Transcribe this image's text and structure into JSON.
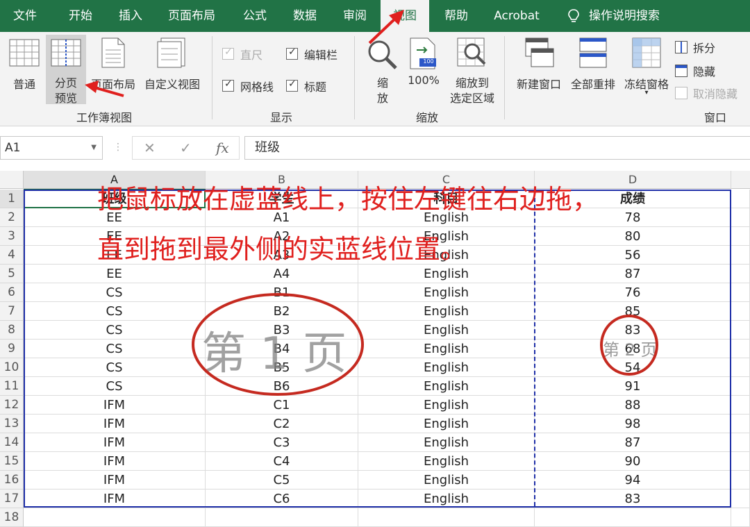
{
  "menu": {
    "tabs": [
      {
        "label": "文件",
        "active": false
      },
      {
        "label": "开始",
        "active": false
      },
      {
        "label": "插入",
        "active": false
      },
      {
        "label": "页面布局",
        "active": false
      },
      {
        "label": "公式",
        "active": false
      },
      {
        "label": "数据",
        "active": false
      },
      {
        "label": "审阅",
        "active": false
      },
      {
        "label": "视图",
        "active": true
      },
      {
        "label": "帮助",
        "active": false
      },
      {
        "label": "Acrobat",
        "active": false
      }
    ],
    "tell_me": "操作说明搜索",
    "accent_color": "#217346"
  },
  "ribbon": {
    "workbook_views": {
      "group_label": "工作簿视图",
      "normal": "普通",
      "page_break_line1": "分页",
      "page_break_line2": "预览",
      "page_layout": "页面布局",
      "custom_views": "自定义视图"
    },
    "show": {
      "group_label": "显示",
      "ruler": {
        "label": "直尺",
        "checked": true,
        "disabled": true
      },
      "formula_bar": {
        "label": "编辑栏",
        "checked": true
      },
      "gridlines": {
        "label": "网格线",
        "checked": true
      },
      "headings": {
        "label": "标题",
        "checked": true
      }
    },
    "zoom": {
      "group_label": "缩放",
      "zoom_line1": "缩",
      "zoom_line2": "放",
      "zoom_100": "100%",
      "zoom_icon_text": "100",
      "zoom_sel_line1": "缩放到",
      "zoom_sel_line2": "选定区域"
    },
    "window": {
      "group_label": "窗口",
      "new_window": "新建窗口",
      "arrange_all": "全部重排",
      "freeze_panes": "冻结窗格",
      "split": "拆分",
      "hide": "隐藏",
      "unhide": "取消隐藏"
    }
  },
  "formula_bar": {
    "name_box": "A1",
    "formula": "班级",
    "fx": "fx"
  },
  "sheet": {
    "columns": [
      "A",
      "B",
      "C",
      "D"
    ],
    "rows": [
      [
        "班级",
        "学生",
        "科目",
        "成绩"
      ],
      [
        "EE",
        "A1",
        "English",
        "78"
      ],
      [
        "EE",
        "A2",
        "English",
        "80"
      ],
      [
        "EE",
        "A3",
        "English",
        "56"
      ],
      [
        "EE",
        "A4",
        "English",
        "87"
      ],
      [
        "CS",
        "B1",
        "English",
        "76"
      ],
      [
        "CS",
        "B2",
        "English",
        "85"
      ],
      [
        "CS",
        "B3",
        "English",
        "83"
      ],
      [
        "CS",
        "B4",
        "English",
        "68"
      ],
      [
        "CS",
        "B5",
        "English",
        "54"
      ],
      [
        "CS",
        "B6",
        "English",
        "91"
      ],
      [
        "IFM",
        "C1",
        "English",
        "88"
      ],
      [
        "IFM",
        "C2",
        "English",
        "98"
      ],
      [
        "IFM",
        "C3",
        "English",
        "87"
      ],
      [
        "IFM",
        "C4",
        "English",
        "90"
      ],
      [
        "IFM",
        "C5",
        "English",
        "94"
      ],
      [
        "IFM",
        "C6",
        "English",
        "83"
      ],
      [
        "",
        "",
        "",
        ""
      ]
    ],
    "row_numbers": [
      "1",
      "2",
      "3",
      "4",
      "5",
      "6",
      "7",
      "8",
      "9",
      "10",
      "11",
      "12",
      "13",
      "14",
      "15",
      "16",
      "17",
      "18"
    ],
    "page_watermark_1": "第 1 页",
    "page_watermark_2": "第 2 页"
  },
  "annotation": {
    "line1": "把鼠标放在虚蓝线上，按住左键往右边拖，",
    "line2": "直到拖到最外侧的实蓝线位置。",
    "color": "#e0201e"
  }
}
